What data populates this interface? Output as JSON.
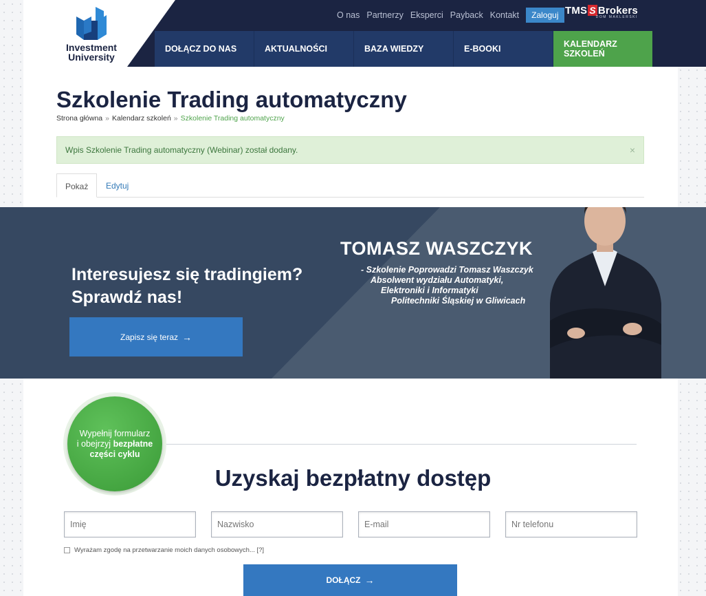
{
  "logo": {
    "line1": "Investment",
    "line2": "University"
  },
  "topnav": {
    "items": [
      "O nas",
      "Partnerzy",
      "Eksperci",
      "Payback",
      "Kontakt"
    ],
    "login": "Zaloguj"
  },
  "brand": {
    "name_a": "TMS",
    "name_s": "S",
    "name_b": "Brokers",
    "sub": "DOM MAKLERSKI"
  },
  "mainnav": {
    "items": [
      "DOŁĄCZ DO NAS",
      "AKTUALNOŚCI",
      "BAZA WIEDZY",
      "E-BOOKI"
    ],
    "highlight_line1": "KALENDARZ",
    "highlight_line2": "SZKOLEŃ"
  },
  "page": {
    "title": "Szkolenie Trading automatyczny",
    "breadcrumb": [
      "Strona główna",
      "Kalendarz szkoleń",
      "Szkolenie Trading automatyczny"
    ],
    "breadcrumb_sep": "»",
    "alert": "Wpis Szkolenie Trading automatyczny (Webinar) został dodany.",
    "alert_close": "×",
    "tabs": [
      "Pokaż",
      "Edytuj"
    ]
  },
  "hero": {
    "question_line1": "Interesujesz się tradingiem?",
    "question_line2": "Sprawdź nas!",
    "cta": "Zapisz się teraz",
    "arrow": "→",
    "name": "TOMASZ WASZCZYK",
    "bio": [
      "- Szkolenie Poprowadzi Tomasz Waszczyk",
      "Absolwent wydziału Automatyki,",
      "Elektroniki i Informatyki",
      "Politechniki Śląskiej w Gliwicach"
    ]
  },
  "form": {
    "badge_line1": "Wypełnij formularz",
    "badge_line2a": "i obejrzyj ",
    "badge_line2b": "bezpłatne",
    "badge_line3": "części cyklu",
    "title": "Uzyskaj bezpłatny dostęp",
    "placeholders": {
      "first_name": "Imię",
      "last_name": "Nazwisko",
      "email": "E-mail",
      "phone": "Nr telefonu"
    },
    "consent": "Wyrażam zgodę na przetwarzanie moich danych osobowych... [?]",
    "submit": "DOŁĄCZ"
  },
  "colors": {
    "navy": "#1b2442",
    "nav_blue": "#223a68",
    "green": "#4ea34b",
    "button_blue": "#3478c0"
  }
}
